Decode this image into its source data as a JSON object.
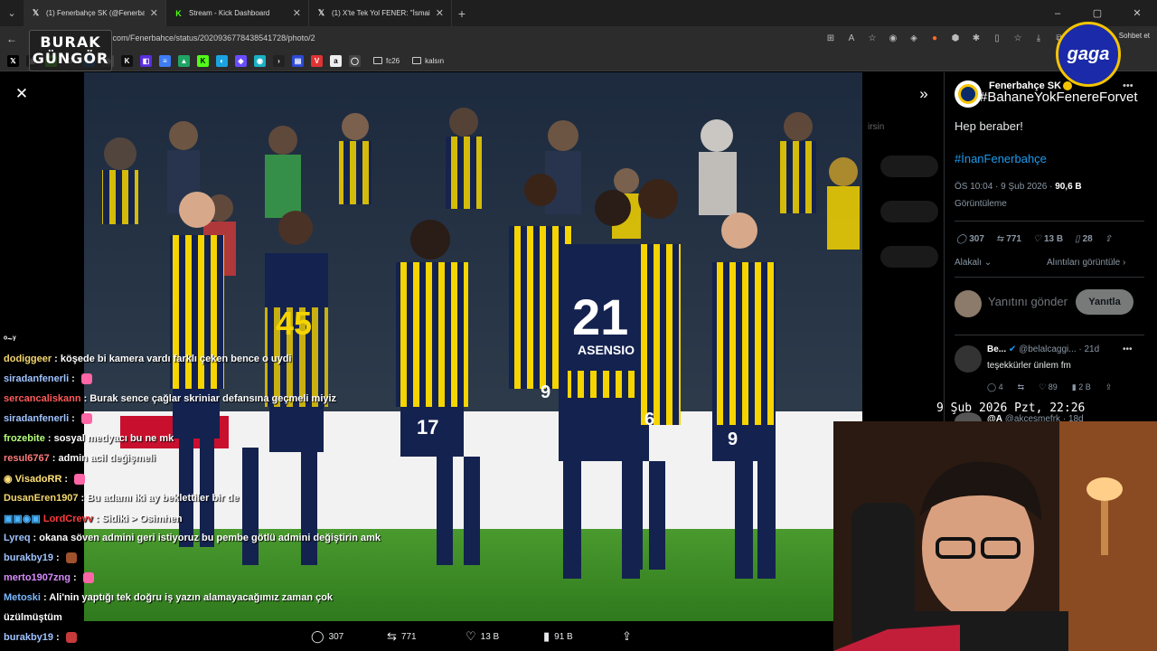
{
  "browser": {
    "tabs": [
      {
        "icon": "X",
        "title": "(1) Fenerbahçe SK (@Fenerbahçe)",
        "active": true
      },
      {
        "icon": "K",
        "title": "Stream - Kick Dashboard",
        "active": false
      },
      {
        "icon": "X",
        "title": "(1) X'te Tek Yol FENER: \"İsmail Yük",
        "active": false
      }
    ],
    "url": ".com/Fenerbahce/status/2020936778438541728/photo/2",
    "chat_button": "Sohbet et",
    "bookmark_folders": [
      "fc26",
      "kalsın"
    ]
  },
  "overlay": {
    "logo_left_line1": "BURAK",
    "logo_left_line2": "GÜNGÖR",
    "logo_right": "gaga",
    "clock": "9 Şub 2026 Pzt, 22:26"
  },
  "media": {
    "actions": {
      "replies": "307",
      "reposts": "771",
      "likes": "13 B",
      "views": "91 B"
    },
    "ghost_text": "irsin",
    "ghost_pills": [
      "Takip et",
      "Takip et",
      "Takip et"
    ]
  },
  "tweet": {
    "author_name": "Fenerbahçe SK",
    "author_handle": "#BahaneYokFenereForvet",
    "text": "Hep beraber!",
    "hashtag": "#İnanFenerbahçe",
    "time": "ÖS 10:04 · 9 Şub 2026 · ",
    "views_count": "90,6 B",
    "views_label": "Görüntüleme",
    "stats": {
      "replies": "307",
      "reposts": "771",
      "likes": "13 B",
      "bookmarks": "28"
    },
    "sort_left": "Alakalı",
    "sort_right": "Alıntıları görüntüle",
    "reply_placeholder": "Yanıtını gönder",
    "reply_button": "Yanıtla"
  },
  "replies": [
    {
      "name": "Be...",
      "handle": "@belalcaggi...",
      "age": "21d",
      "text": "teşekkürler ünlem fm",
      "comments": "4",
      "likes": "89",
      "views": "2 B"
    },
    {
      "name": "@A",
      "handle": "@akcesmefrk",
      "age": "18d"
    }
  ],
  "chat": [
    {
      "user": "ᵒ~ᵞ",
      "color": "#ffffff",
      "text": ""
    },
    {
      "user": "dodiggeer",
      "color": "#f5d76e",
      "text": "köşede bi kamera vardı farklı çeken bence o uydi"
    },
    {
      "user": "siradanfenerli",
      "color": "#9fc3ff",
      "text": ""
    },
    {
      "user": "sercancaliskann",
      "color": "#ff5a5a",
      "text": "Burak sence çağlar skriniar defansına geçmeli miyiz"
    },
    {
      "user": "siradanfenerli",
      "color": "#9fc3ff",
      "text": ""
    },
    {
      "user": "frozebite",
      "color": "#b6ff7a",
      "text": "sosyal medyacı bu ne mk"
    },
    {
      "user": "resul6767",
      "color": "#ff7a7a",
      "text": "admin acil değişmeli"
    },
    {
      "user": "VisadoRR",
      "color": "#ffe07a",
      "text": ""
    },
    {
      "user": "DusanEren1907",
      "color": "#f5d76e",
      "text": "Bu adamı iki ay beklettiler bir de"
    },
    {
      "user": "LordCrevv",
      "color": "#ff3b3b",
      "text": "Sidiki > Osimhen"
    },
    {
      "user": "Lyreq",
      "color": "#9fc3ff",
      "text": "okana söven admini geri istiyoruz bu pembe götlü admini değiştirin amk"
    },
    {
      "user": "burakby19",
      "color": "#ffffff",
      "text": ""
    },
    {
      "user": "merto1907zng",
      "color": "#d98cff",
      "text": ""
    },
    {
      "user": "Metoski",
      "color": "#7ab8ff",
      "text": "Ali'nin yaptığı tek doğru iş yazın alamayacağımız zaman çok"
    },
    {
      "user": "",
      "color": "#ffffff",
      "text": "üzülmüştüm"
    },
    {
      "user": "burakby19",
      "color": "#ffffff",
      "text": ""
    }
  ],
  "players": [
    {
      "number": "45"
    },
    {
      "number": "9"
    },
    {
      "number": "21",
      "name": "ASENSIO"
    },
    {
      "number": "6"
    },
    {
      "number": "9"
    },
    {
      "number": "17"
    },
    {
      "number": "5"
    }
  ],
  "colors": {
    "fb_yellow": "#f5d400",
    "fb_navy": "#14224f",
    "x_blue": "#1d9bf0"
  }
}
